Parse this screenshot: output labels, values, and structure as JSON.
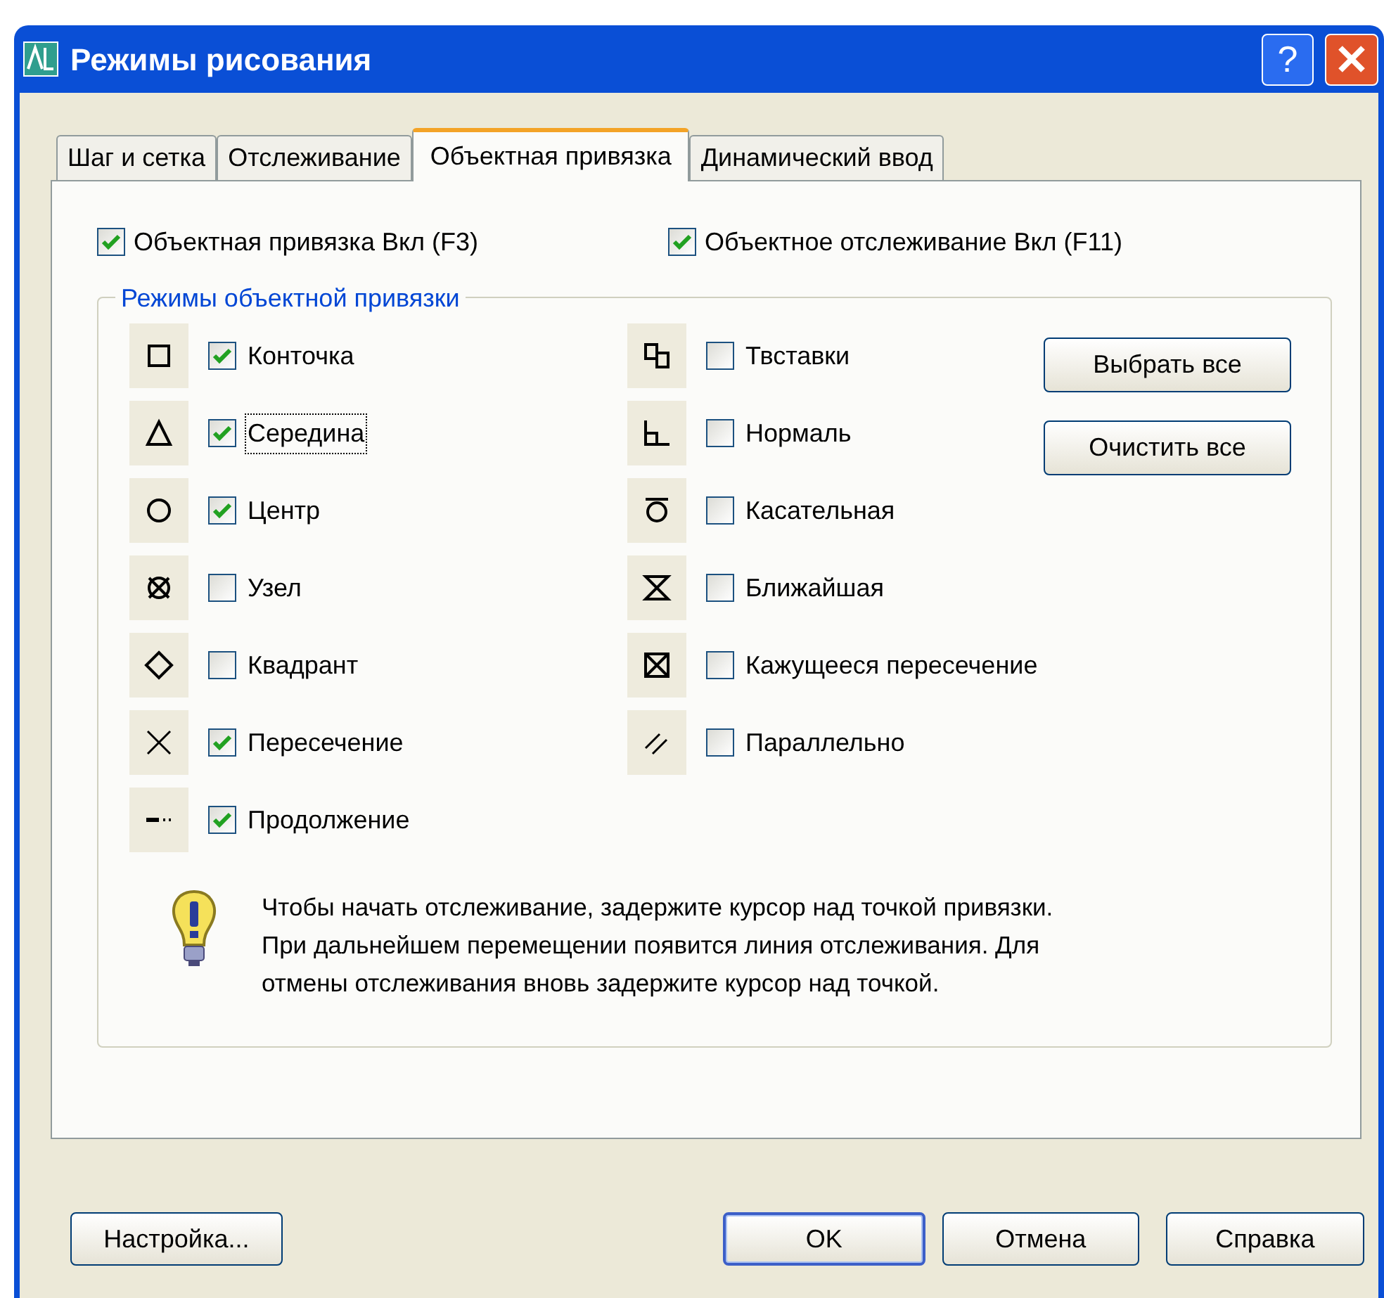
{
  "window": {
    "title": "Режимы рисования",
    "help_button": "?"
  },
  "tabs": [
    {
      "label": "Шаг и сетка",
      "selected": false
    },
    {
      "label": "Отслеживание",
      "selected": false
    },
    {
      "label": "Объектная привязка",
      "selected": true
    },
    {
      "label": "Динамический ввод",
      "selected": false
    }
  ],
  "toggles": [
    {
      "label": "Объектная привязка Вкл (F3)",
      "checked": true
    },
    {
      "label": "Объектное отслеживание Вкл (F11)",
      "checked": true
    }
  ],
  "group": {
    "title": "Режимы объектной привязки",
    "left": [
      {
        "kind": "endpoint",
        "label": "Конточка",
        "checked": true,
        "focused": false
      },
      {
        "kind": "midpoint",
        "label": "Середина",
        "checked": true,
        "focused": true
      },
      {
        "kind": "center",
        "label": "Центр",
        "checked": true,
        "focused": false
      },
      {
        "kind": "node",
        "label": "Узел",
        "checked": false,
        "focused": false
      },
      {
        "kind": "quadrant",
        "label": "Квадрант",
        "checked": false,
        "focused": false
      },
      {
        "kind": "intersection",
        "label": "Пересечение",
        "checked": true,
        "focused": false
      },
      {
        "kind": "extension",
        "label": "Продолжение",
        "checked": true,
        "focused": false
      }
    ],
    "right": [
      {
        "kind": "insertion",
        "label": "Твставки",
        "checked": false,
        "focused": false
      },
      {
        "kind": "perpendicular",
        "label": "Нормаль",
        "checked": false,
        "focused": false
      },
      {
        "kind": "tangent",
        "label": "Касательная",
        "checked": false,
        "focused": false
      },
      {
        "kind": "nearest",
        "label": "Ближайшая",
        "checked": false,
        "focused": false
      },
      {
        "kind": "apparent",
        "label": "Кажущееся пересечение",
        "checked": false,
        "focused": false
      },
      {
        "kind": "parallel",
        "label": "Параллельно",
        "checked": false,
        "focused": false
      }
    ],
    "buttons": [
      "Выбрать все",
      "Очистить все"
    ],
    "tip": "Чтобы начать отслеживание, задержите курсор над точкой привязки.\nПри дальнейшем перемещении появится линия отслеживания. Для\nотмены отслеживания вновь задержите курсор над точкой."
  },
  "footer_buttons": [
    {
      "label": "Настройка...",
      "default": false
    },
    {
      "label": "OK",
      "default": true
    },
    {
      "label": "Отмена",
      "default": false
    },
    {
      "label": "Справка",
      "default": false
    }
  ]
}
